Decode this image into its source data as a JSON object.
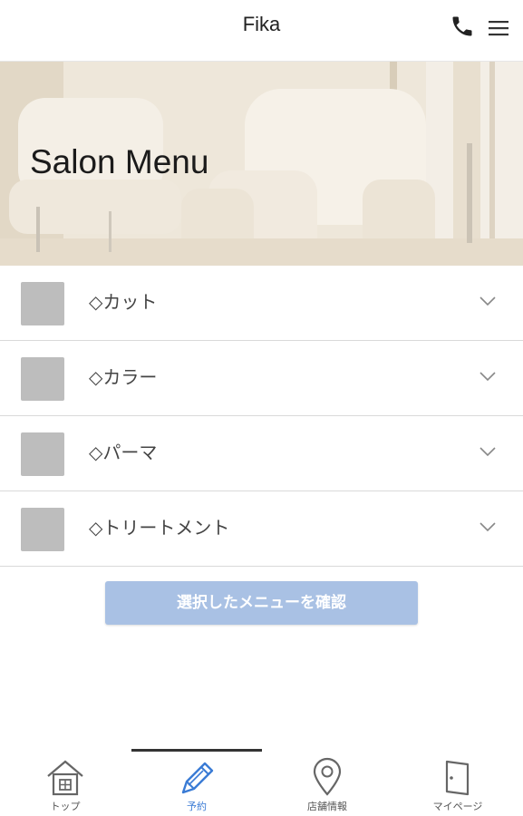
{
  "header": {
    "title": "Fika",
    "phone_icon": "phone-icon",
    "menu_icon": "hamburger-menu-icon"
  },
  "hero": {
    "title": "Salon Menu"
  },
  "menu": {
    "items": [
      {
        "label": "◇カット"
      },
      {
        "label": "◇カラー"
      },
      {
        "label": "◇パーマ"
      },
      {
        "label": "◇トリートメント"
      }
    ]
  },
  "confirm_button": {
    "label": "選択したメニューを確認",
    "color": "#a9c1e4"
  },
  "bottom_nav": {
    "active_index": 1,
    "items": [
      {
        "label": "トップ",
        "icon": "home-icon"
      },
      {
        "label": "予約",
        "icon": "pencil-icon"
      },
      {
        "label": "店舗情報",
        "icon": "map-pin-icon"
      },
      {
        "label": "マイページ",
        "icon": "door-icon"
      }
    ],
    "active_color": "#3a7bd5"
  }
}
